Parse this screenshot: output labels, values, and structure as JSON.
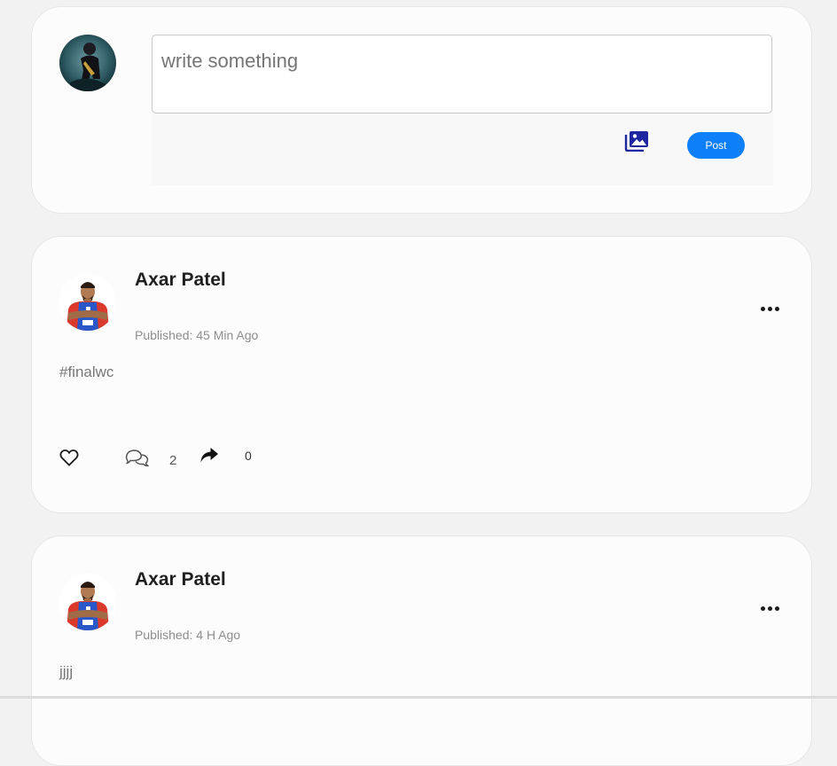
{
  "composer": {
    "placeholder": "write something",
    "post_label": "Post",
    "photo_icon": "photo-gallery-icon",
    "avatar": "user-avatar"
  },
  "posts": [
    {
      "author": "Axar Patel",
      "published": "Published: 45 Min Ago",
      "text": "#finalwc",
      "comment_count": "2",
      "share_count": "0",
      "icons": [
        "heart-icon",
        "comment-icon",
        "share-icon",
        "more-options-icon"
      ]
    },
    {
      "author": "Axar Patel",
      "published": "Published: 4 H Ago",
      "text": "jjjj"
    }
  ],
  "colors": {
    "accent": "#0d7ff8",
    "page_bg": "#f3f2f2",
    "card_bg": "#fcfcfc"
  }
}
